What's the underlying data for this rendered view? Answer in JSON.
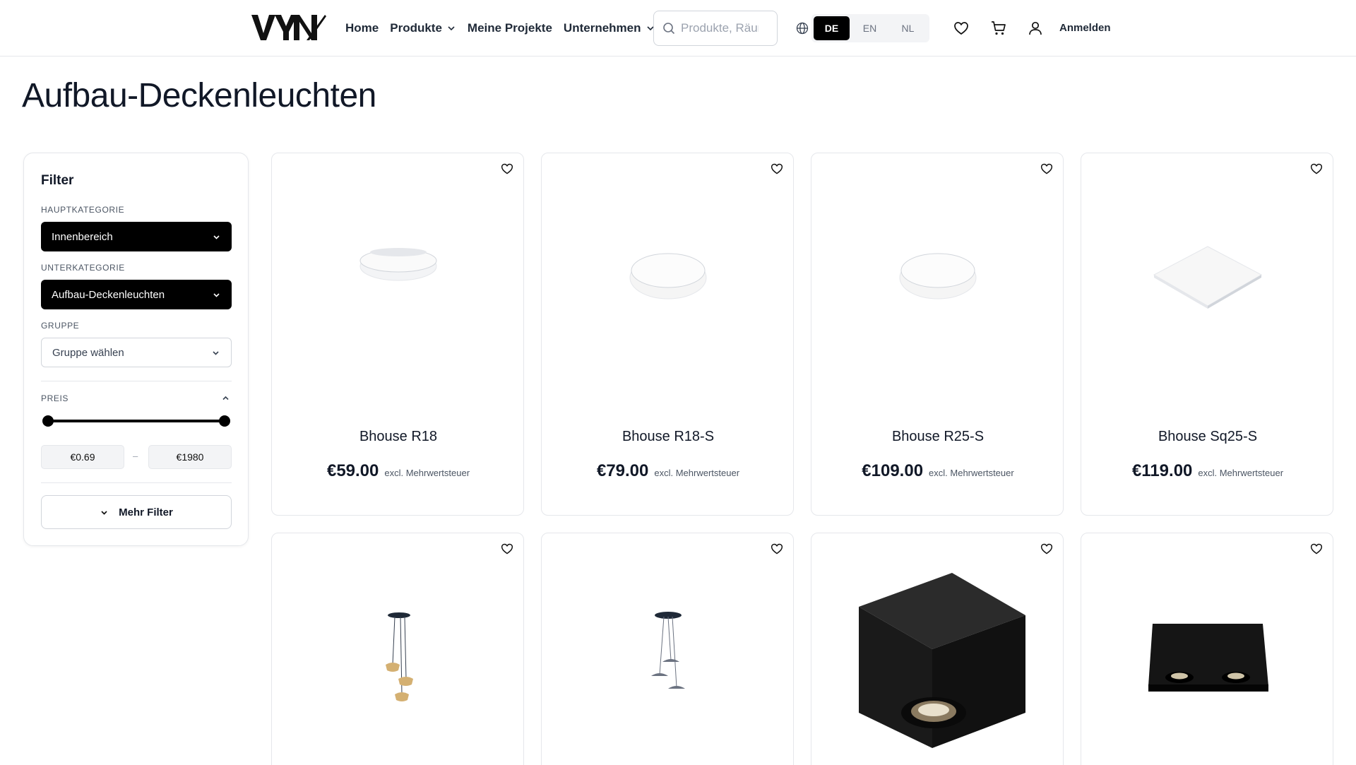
{
  "header": {
    "logo_text": "VYN",
    "nav": [
      {
        "label": "Home"
      },
      {
        "label": "Produkte"
      },
      {
        "label": "Meine Projekte"
      },
      {
        "label": "Unternehmen"
      }
    ],
    "search_placeholder": "Produkte, Räume",
    "languages": [
      "DE",
      "EN",
      "NL"
    ],
    "active_language": "DE",
    "login_label": "Anmelden"
  },
  "page": {
    "title": "Aufbau-Deckenleuchten"
  },
  "filter": {
    "title": "Filter",
    "main_category_label": "HAUPTKATEGORIE",
    "main_category_value": "Innenbereich",
    "sub_category_label": "UNTERKATEGORIE",
    "sub_category_value": "Aufbau-Deckenleuchten",
    "group_label": "GRUPPE",
    "group_placeholder": "Gruppe wählen",
    "price_label": "PREIS",
    "price_min": "€0.69",
    "price_separator": "–",
    "price_max": "€1980",
    "more_filters_label": "Mehr Filter"
  },
  "products": [
    {
      "name": "Bhouse R18",
      "price": "€59.00",
      "tax": "excl. Mehrwertsteuer"
    },
    {
      "name": "Bhouse R18-S",
      "price": "€79.00",
      "tax": "excl. Mehrwertsteuer"
    },
    {
      "name": "Bhouse R25-S",
      "price": "€109.00",
      "tax": "excl. Mehrwertsteuer"
    },
    {
      "name": "Bhouse Sq25-S",
      "price": "€119.00",
      "tax": "excl. Mehrwertsteuer"
    }
  ],
  "colors": {
    "accent": "#000000",
    "border": "#e5e7eb",
    "text": "#111827",
    "muted": "#6b7280"
  }
}
